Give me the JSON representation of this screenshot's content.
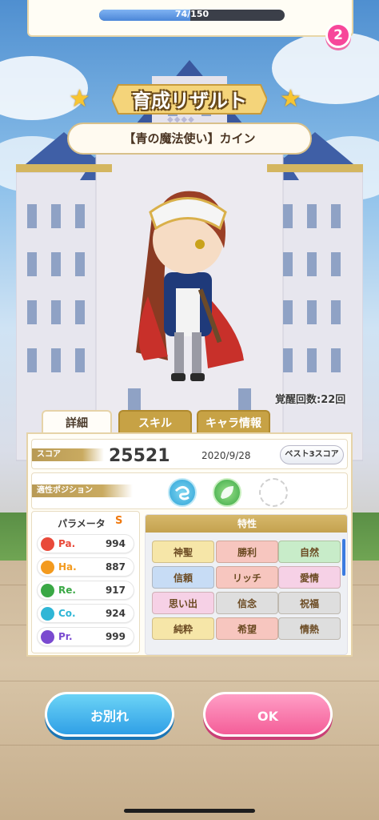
{
  "gauge": {
    "text": "74/150",
    "value": 74,
    "max": 150,
    "fill_fraction": 0.493
  },
  "notification_badge": "2",
  "title": "育成リザルト",
  "character_name": "【青の魔法使い】カイン",
  "awakening": "覚醒回数:22回",
  "tabs": [
    {
      "label": "詳細",
      "active": true
    },
    {
      "label": "スキル",
      "active": false
    },
    {
      "label": "キャラ情報",
      "active": false
    }
  ],
  "score": {
    "label": "スコア",
    "value": "25521",
    "date": "2020/9/28",
    "best_button": "ベスト3スコア"
  },
  "position": {
    "label": "適性ポジション",
    "icons": [
      "wind-icon",
      "leaf-icon",
      "empty-slot-icon"
    ]
  },
  "params": {
    "title": "パラメータ",
    "rank": "S",
    "items": [
      {
        "name": "Pa.",
        "value": "994",
        "color": "#e94a3a",
        "icon": "flame-icon"
      },
      {
        "name": "Ha.",
        "value": "887",
        "color": "#f39a1e",
        "icon": "sun-icon"
      },
      {
        "name": "Re.",
        "value": "917",
        "color": "#3aa845",
        "icon": "clover-icon"
      },
      {
        "name": "Co.",
        "value": "924",
        "color": "#2fb6d6",
        "icon": "swirl-icon"
      },
      {
        "name": "Pr.",
        "value": "999",
        "color": "#7a4ad0",
        "icon": "gem-icon"
      }
    ]
  },
  "traits": {
    "title": "特性",
    "items": [
      {
        "label": "神聖",
        "color": "#f6e6a8"
      },
      {
        "label": "勝利",
        "color": "#f7c6bf"
      },
      {
        "label": "自然",
        "color": "#c8ecc9"
      },
      {
        "label": "信頼",
        "color": "#c7dcf5"
      },
      {
        "label": "リッチ",
        "color": "#f7c6bf"
      },
      {
        "label": "愛情",
        "color": "#f6d1e6"
      },
      {
        "label": "思い出",
        "color": "#f6d1e6"
      },
      {
        "label": "信念",
        "color": "#dedede"
      },
      {
        "label": "祝福",
        "color": "#dedede"
      },
      {
        "label": "純粋",
        "color": "#f6e6a8"
      },
      {
        "label": "希望",
        "color": "#f7c6bf"
      },
      {
        "label": "情熱",
        "color": "#dedede"
      }
    ]
  },
  "buttons": {
    "farewell": "お別れ",
    "ok": "OK"
  }
}
